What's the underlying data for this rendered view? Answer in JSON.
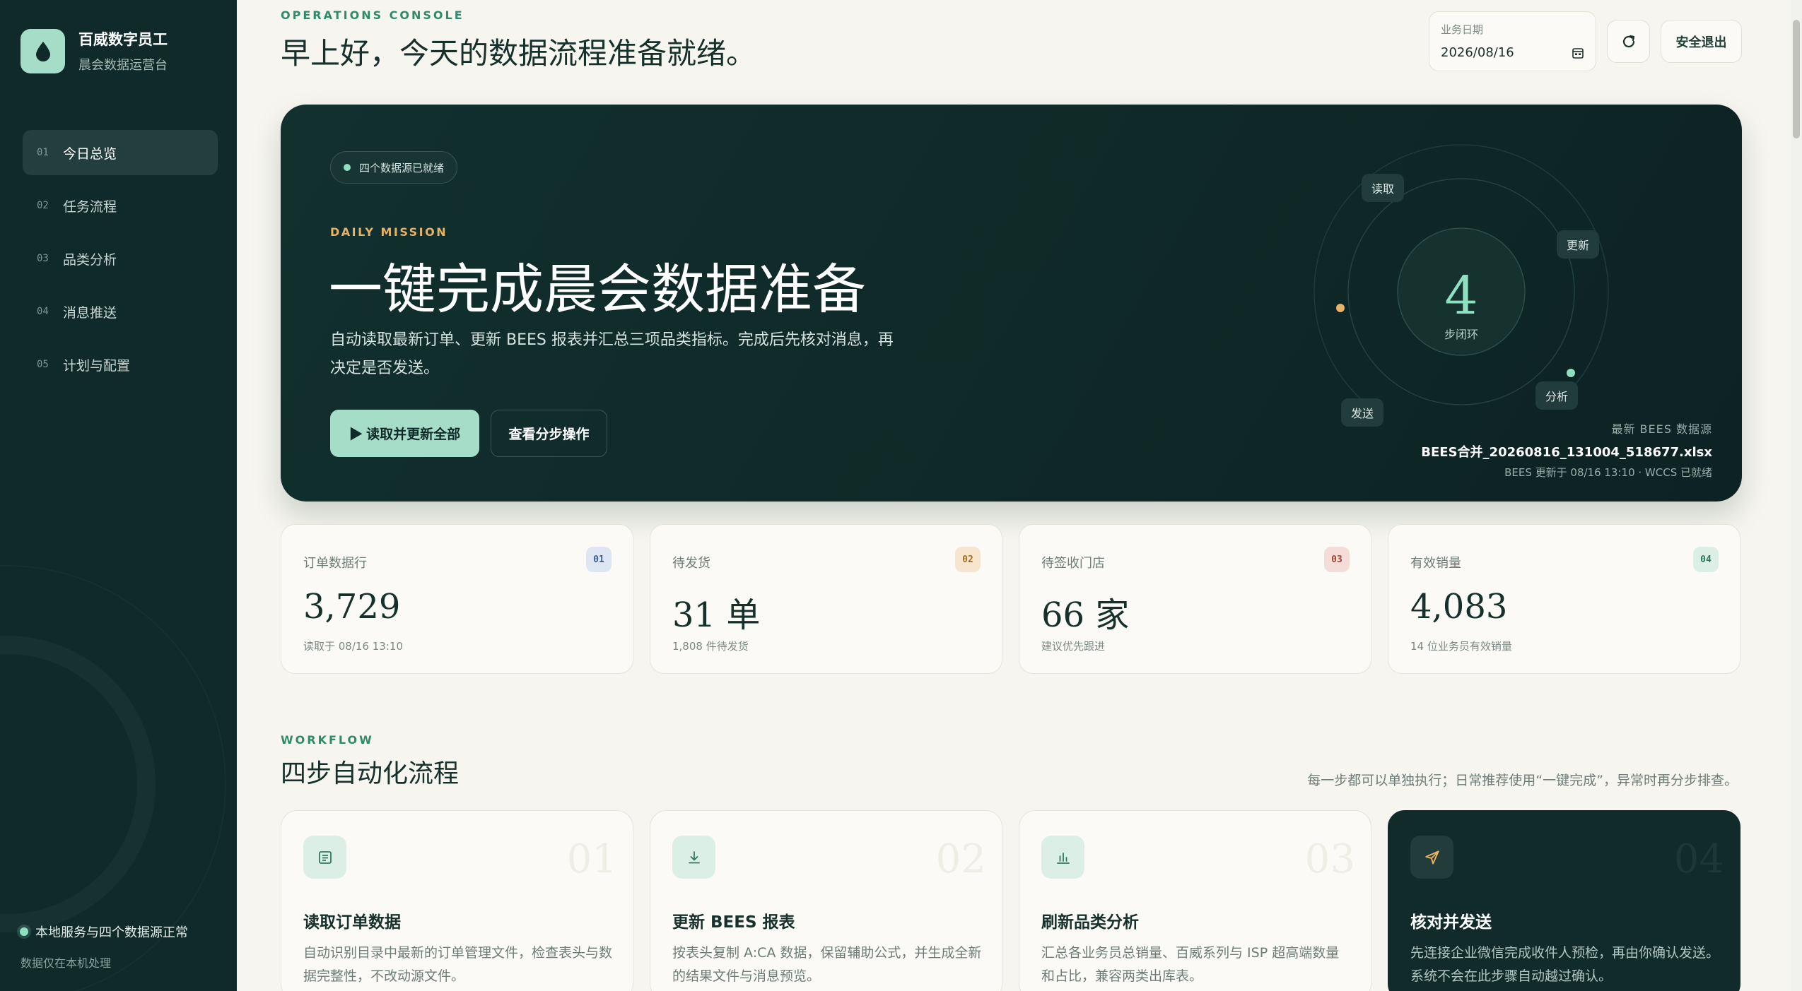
{
  "brand": {
    "name": "百威数字员工",
    "subtitle": "晨会数据运营台"
  },
  "nav": [
    {
      "num": "01",
      "label": "今日总览",
      "active": true
    },
    {
      "num": "02",
      "label": "任务流程"
    },
    {
      "num": "03",
      "label": "品类分析"
    },
    {
      "num": "04",
      "label": "消息推送"
    },
    {
      "num": "05",
      "label": "计划与配置"
    }
  ],
  "sidebar_footer": {
    "status": "本地服务与四个数据源正常",
    "note": "数据仅在本机处理"
  },
  "header": {
    "eyebrow": "OPERATIONS CONSOLE",
    "greeting": "早上好，今天的数据流程准备就绪。",
    "date_label": "业务日期",
    "date_value": "2026/08/16",
    "logout": "安全退出"
  },
  "hero": {
    "badge": "四个数据源已就绪",
    "eyebrow": "DAILY MISSION",
    "title": "一键完成晨会数据准备",
    "desc": "自动读取最新订单、更新 BEES 报表并汇总三项品类指标。完成后先核对消息，再决定是否发送。",
    "primary_btn": "▶ 读取并更新全部",
    "secondary_btn": "查看分步操作",
    "orbit": {
      "value": "4",
      "label": "步闭环",
      "tags": [
        "读取",
        "更新",
        "分析",
        "发送"
      ]
    },
    "source_label": "最新 BEES 数据源",
    "source_file": "BEES合并_20260816_131004_518677.xlsx",
    "source_status": "BEES 更新于 08/16 13:10 · WCCS 已就绪"
  },
  "stats": [
    {
      "label": "订单数据行",
      "badge": "01",
      "value": "3,729",
      "sub": "读取于 08/16 13:10",
      "badge_bg": "#dfe6f3",
      "badge_fg": "#3b5d93"
    },
    {
      "label": "待发货",
      "badge": "02",
      "value": "31 单",
      "sub": "1,808 件待发货",
      "badge_bg": "#f6e6cf",
      "badge_fg": "#a56a21"
    },
    {
      "label": "待签收门店",
      "badge": "03",
      "value": "66 家",
      "sub": "建议优先跟进",
      "badge_bg": "#f4dcd8",
      "badge_fg": "#a3463a"
    },
    {
      "label": "有效销量",
      "badge": "04",
      "value": "4,083",
      "sub": "14 位业务员有效销量",
      "badge_bg": "#dcefe6",
      "badge_fg": "#2f7a5f"
    }
  ],
  "workflow": {
    "eyebrow": "WORKFLOW",
    "title": "四步自动化流程",
    "note": "每一步都可以单独执行；日常推荐使用“一键完成”，异常时再分步排查。",
    "steps": [
      {
        "num": "01",
        "name": "读取订单数据",
        "desc": "自动识别目录中最新的订单管理文件，检查表头与数据完整性，不改动源文件。",
        "icon": "document-icon"
      },
      {
        "num": "02",
        "name": "更新 BEES 报表",
        "desc": "按表头复制 A:CA 数据，保留辅助公式，并生成全新的结果文件与消息预览。",
        "icon": "download-icon"
      },
      {
        "num": "03",
        "name": "刷新品类分析",
        "desc": "汇总各业务员总销量、百威系列与 ISP 超高端数量和占比，兼容两类出库表。",
        "icon": "bar-chart-icon"
      },
      {
        "num": "04",
        "name": "核对并发送",
        "desc": "先连接企业微信完成收件人预检，再由你确认发送。系统不会在此步骤自动越过确认。",
        "icon": "send-icon"
      }
    ]
  },
  "colors": {
    "sidebar": "#0f2a29",
    "accent": "#a6ddc8",
    "mission": "#e6b267",
    "page": "#f6f5ef"
  }
}
